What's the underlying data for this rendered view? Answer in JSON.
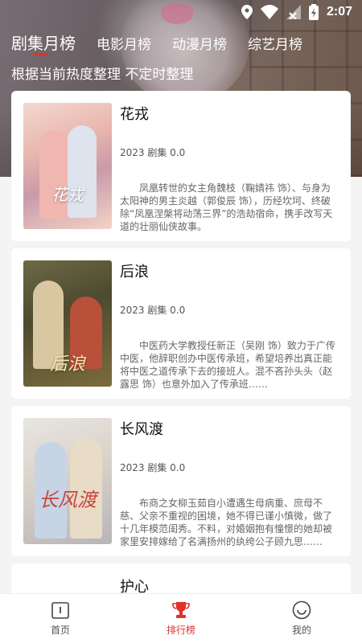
{
  "status_bar": {
    "time": "2:07"
  },
  "tabs": [
    {
      "label": "剧集月榜",
      "active": true
    },
    {
      "label": "电影月榜",
      "active": false
    },
    {
      "label": "动漫月榜",
      "active": false
    },
    {
      "label": "综艺月榜",
      "active": false
    }
  ],
  "subtitle": "根据当前热度整理 不定时整理",
  "items": [
    {
      "title": "花戎",
      "poster_text": "花戎",
      "meta": "2023 剧集 0.0",
      "desc": "凤凰转世的女主角魏枝（鞠婧祎 饰）、与身为太阳神的男主炎越（郭俊辰 饰），历经坎坷、终破除“凤凰涅槃将动荡三界”的浩劫宿命，携手改写天道的壮丽仙侠故事。"
    },
    {
      "title": "后浪",
      "poster_text": "后浪",
      "meta": "2023 剧集 0.0",
      "desc": "中医药大学教授任新正（吴刚 饰）致力于广传中医，他辞职创办中医传承班，希望培养出真正能将中医之道传承下去的接班人。混不吝孙头头（赵露思 饰）也意外加入了传承班……"
    },
    {
      "title": "长风渡",
      "poster_text": "长风渡",
      "meta": "2023 剧集 0.0",
      "desc": "布商之女柳玉茹自小遭遇生母病重、庶母不慈、父亲不重视的困境，她不得已谨小慎微，做了十几年模范闺秀。不料，对婚姻抱有憧憬的她却被家里安排嫁给了名满扬州的纨绔公子顾九思……"
    },
    {
      "title": "护心"
    }
  ],
  "bottom_nav": [
    {
      "label": "首页",
      "icon": "home-icon",
      "active": false
    },
    {
      "label": "排行榜",
      "icon": "trophy-icon",
      "active": true
    },
    {
      "label": "我的",
      "icon": "smiley-icon",
      "active": false
    }
  ],
  "colors": {
    "accent": "#e0312d"
  }
}
